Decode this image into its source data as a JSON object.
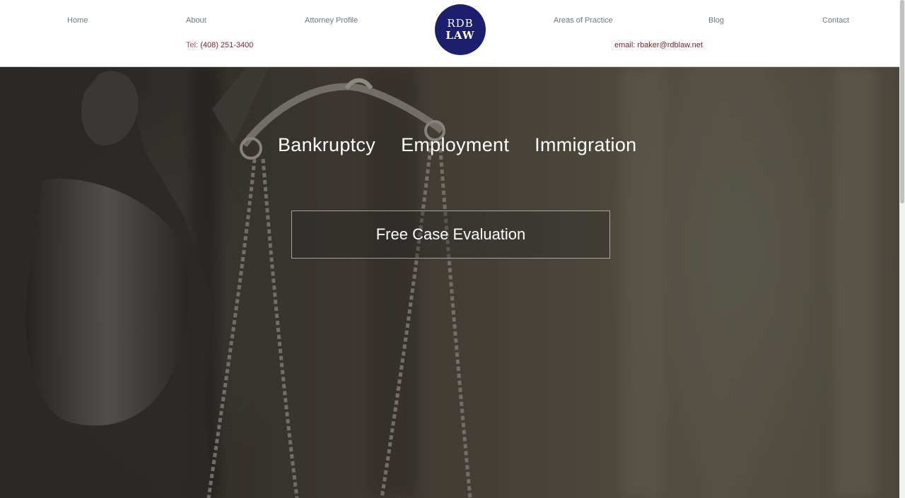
{
  "header": {
    "nav_left": [
      {
        "label": "Home"
      },
      {
        "label": "About"
      },
      {
        "label": "Attorney Profile"
      }
    ],
    "nav_right": [
      {
        "label": "Areas of Practice"
      },
      {
        "label": "Blog"
      },
      {
        "label": "Contact"
      }
    ],
    "phone": {
      "prefix": "Tel:",
      "value": "(408) 251-3400"
    },
    "email": {
      "prefix": "email:",
      "value": "rbaker@rdblaw.net"
    },
    "logo": {
      "line1": "RDB",
      "line2": "LAW",
      "color": "#1c1f6e"
    }
  },
  "hero": {
    "practice_areas": [
      "Bankruptcy",
      "Employment",
      "Immigration"
    ],
    "cta_label": "Free Case Evaluation"
  },
  "colors": {
    "nav_text": "#707780",
    "contact_text": "#7a1f2b"
  }
}
